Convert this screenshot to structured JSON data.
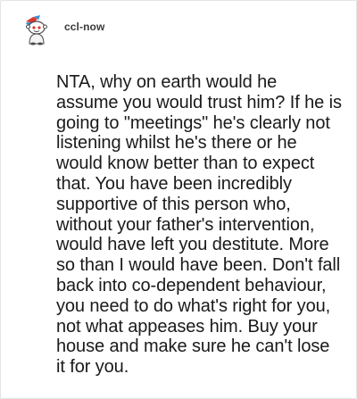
{
  "post": {
    "username": "ccl-now",
    "avatar_icon": "snoo-avatar-icon",
    "comment": "NTA, why on earth would he assume you would trust him? If he is going to \"meetings\" he's clearly not listening whilst he's there or he would know better than to expect that. You have been incredibly supportive of this person who, without your father's intervention, would have left you destitute. More so than I would have been. Don't fall back into co-dependent behaviour, you need to do what's right for you, not what appeases him. Buy your house and make sure he can't lose it for you."
  },
  "colors": {
    "text": "#1a1a1a",
    "username": "#3a3a3a",
    "border": "#e4e4e4",
    "avatar_accent": "#d9392e",
    "avatar_blue": "#3a8fd6"
  }
}
